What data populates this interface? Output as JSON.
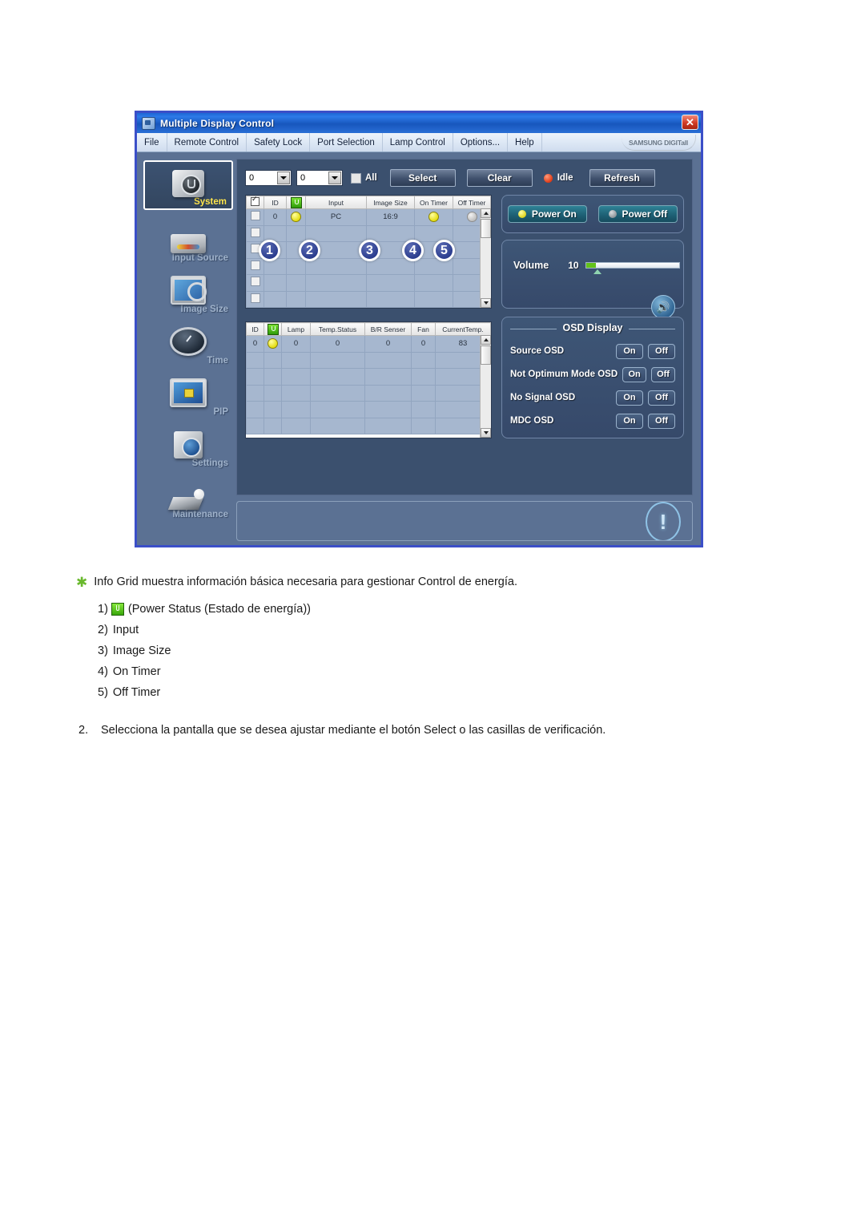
{
  "window": {
    "title": "Multiple Display Control",
    "close_label": "✕",
    "brand": "SAMSUNG DIGITall",
    "menu": [
      "File",
      "Remote Control",
      "Safety Lock",
      "Port Selection",
      "Lamp Control",
      "Options...",
      "Help"
    ]
  },
  "sidebar": {
    "items": [
      {
        "label": "System",
        "icon": "system-icon",
        "active": true
      },
      {
        "label": "Input Source",
        "icon": "input-source-icon",
        "active": false
      },
      {
        "label": "Image Size",
        "icon": "image-size-icon",
        "active": false
      },
      {
        "label": "Time",
        "icon": "clock-icon",
        "active": false
      },
      {
        "label": "PIP",
        "icon": "pip-icon",
        "active": false
      },
      {
        "label": "Settings",
        "icon": "settings-icon",
        "active": false
      },
      {
        "label": "Maintenance",
        "icon": "maintenance-icon",
        "active": false
      }
    ]
  },
  "toolbar": {
    "combo_from": "0",
    "combo_to": "0",
    "all_label": "All",
    "select_label": "Select",
    "clear_label": "Clear",
    "status_label": "Idle",
    "refresh_label": "Refresh"
  },
  "info_grid": {
    "headers": [
      "",
      "ID",
      "power-icon",
      "Input",
      "Image Size",
      "On Timer",
      "Off Timer"
    ],
    "rows": [
      {
        "id": "0",
        "power": "yellow",
        "input": "PC",
        "image_size": "16:9",
        "on_timer": "yellow",
        "off_timer": "gray"
      }
    ],
    "empty_rows": 5,
    "callouts": [
      "1",
      "2",
      "3",
      "4",
      "5"
    ]
  },
  "lamp_grid": {
    "headers": [
      "ID",
      "power-icon",
      "Lamp",
      "Temp.Status",
      "B/R Senser",
      "Fan",
      "CurrentTemp."
    ],
    "rows": [
      {
        "id": "0",
        "power": "yellow",
        "lamp": "0",
        "temp_status": "0",
        "br_senser": "0",
        "fan": "0",
        "current_temp": "83"
      }
    ],
    "empty_rows": 5
  },
  "power_panel": {
    "power_on_label": "Power On",
    "power_off_label": "Power Off"
  },
  "volume_panel": {
    "label": "Volume",
    "value": "10",
    "min": 0,
    "max": 100,
    "speaker_icon": "speaker-icon"
  },
  "osd_panel": {
    "title": "OSD Display",
    "on_label": "On",
    "off_label": "Off",
    "rows": [
      "Source OSD",
      "Not Optimum Mode OSD",
      "No Signal OSD",
      "MDC OSD"
    ]
  },
  "status_panel": {
    "icon": "exclamation-icon",
    "glyph": "!"
  },
  "document": {
    "bullet_text": "Info Grid muestra información básica necesaria para gestionar Control de energía.",
    "items": [
      {
        "num": "1)",
        "icon": "power-status-icon",
        "text": "(Power Status (Estado de energía))"
      },
      {
        "num": "2)",
        "icon": "",
        "text": "Input"
      },
      {
        "num": "3)",
        "icon": "",
        "text": "Image Size"
      },
      {
        "num": "4)",
        "icon": "",
        "text": "On Timer"
      },
      {
        "num": "5)",
        "icon": "",
        "text": "Off Timer"
      }
    ],
    "step2_number": "2.",
    "step2_text": "Selecciona la pantalla que se desea ajustar mediante el botón Select o las casillas de verificación."
  },
  "colors": {
    "window_frame": "#3b4fc8",
    "titlebar": "#1d66d4",
    "panel_bg": "#3b506e",
    "sidebar_bg": "#5b7193",
    "accent_yellow": "#e4dd13",
    "accent_green": "#63c21a",
    "idle_red": "#e03b16",
    "callout_blue": "#2b3d8e",
    "star_green": "#6ab92e"
  }
}
